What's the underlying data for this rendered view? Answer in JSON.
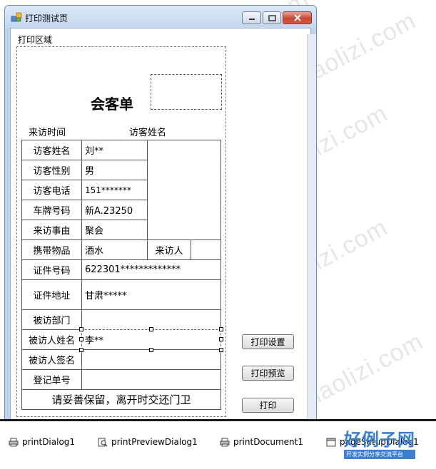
{
  "watermark": {
    "text": "www.haolizi.com"
  },
  "window": {
    "title": "打印测试页",
    "group_label": "打印区域"
  },
  "form": {
    "title": "会客单",
    "visit_time_label": "来访时间",
    "visitor_name_label_top": "访客姓名",
    "rows": {
      "visitor_name": {
        "label": "访客姓名",
        "value": "刘**"
      },
      "visitor_gender": {
        "label": "访客性别",
        "value": "男"
      },
      "visitor_phone": {
        "label": "访客电话",
        "value": "151*******"
      },
      "plate_number": {
        "label": "车牌号码",
        "value": "新A.23250"
      },
      "visit_reason": {
        "label": "来访事由",
        "value": "聚会"
      },
      "carried_items": {
        "label": "携带物品",
        "value": "酒水",
        "extra_label": "来访人"
      },
      "id_number": {
        "label": "证件号码",
        "value": "622301*************"
      },
      "id_address": {
        "label": "证件地址",
        "value": "甘肃*****"
      },
      "host_department": {
        "label": "被访部门",
        "value": ""
      },
      "host_name": {
        "label": "被访人姓名",
        "value": "李**"
      },
      "host_signature": {
        "label": "被访人签名",
        "value": ""
      },
      "registration_number": {
        "label": "登记单号",
        "value": ""
      }
    },
    "footer": "请妥善保留，离开时交还门卫"
  },
  "buttons": {
    "print_settings": "打印设置",
    "print_preview": "打印预览",
    "print": "打印"
  },
  "component_tray": {
    "items": [
      {
        "name": "printDialog1",
        "icon": "printer-icon"
      },
      {
        "name": "printPreviewDialog1",
        "icon": "print-preview-icon"
      },
      {
        "name": "printDocument1",
        "icon": "printer-icon"
      },
      {
        "name": "pageSetupDialog1",
        "icon": "page-setup-icon"
      }
    ]
  },
  "brand": {
    "main": "好例子网",
    "sub": "开发实例分享交流平台"
  },
  "colors": {
    "window_border": "#6e8fb4",
    "titlebar": "#dce9f7",
    "close_button": "#c9462f",
    "brand": "#3a7fd4"
  }
}
